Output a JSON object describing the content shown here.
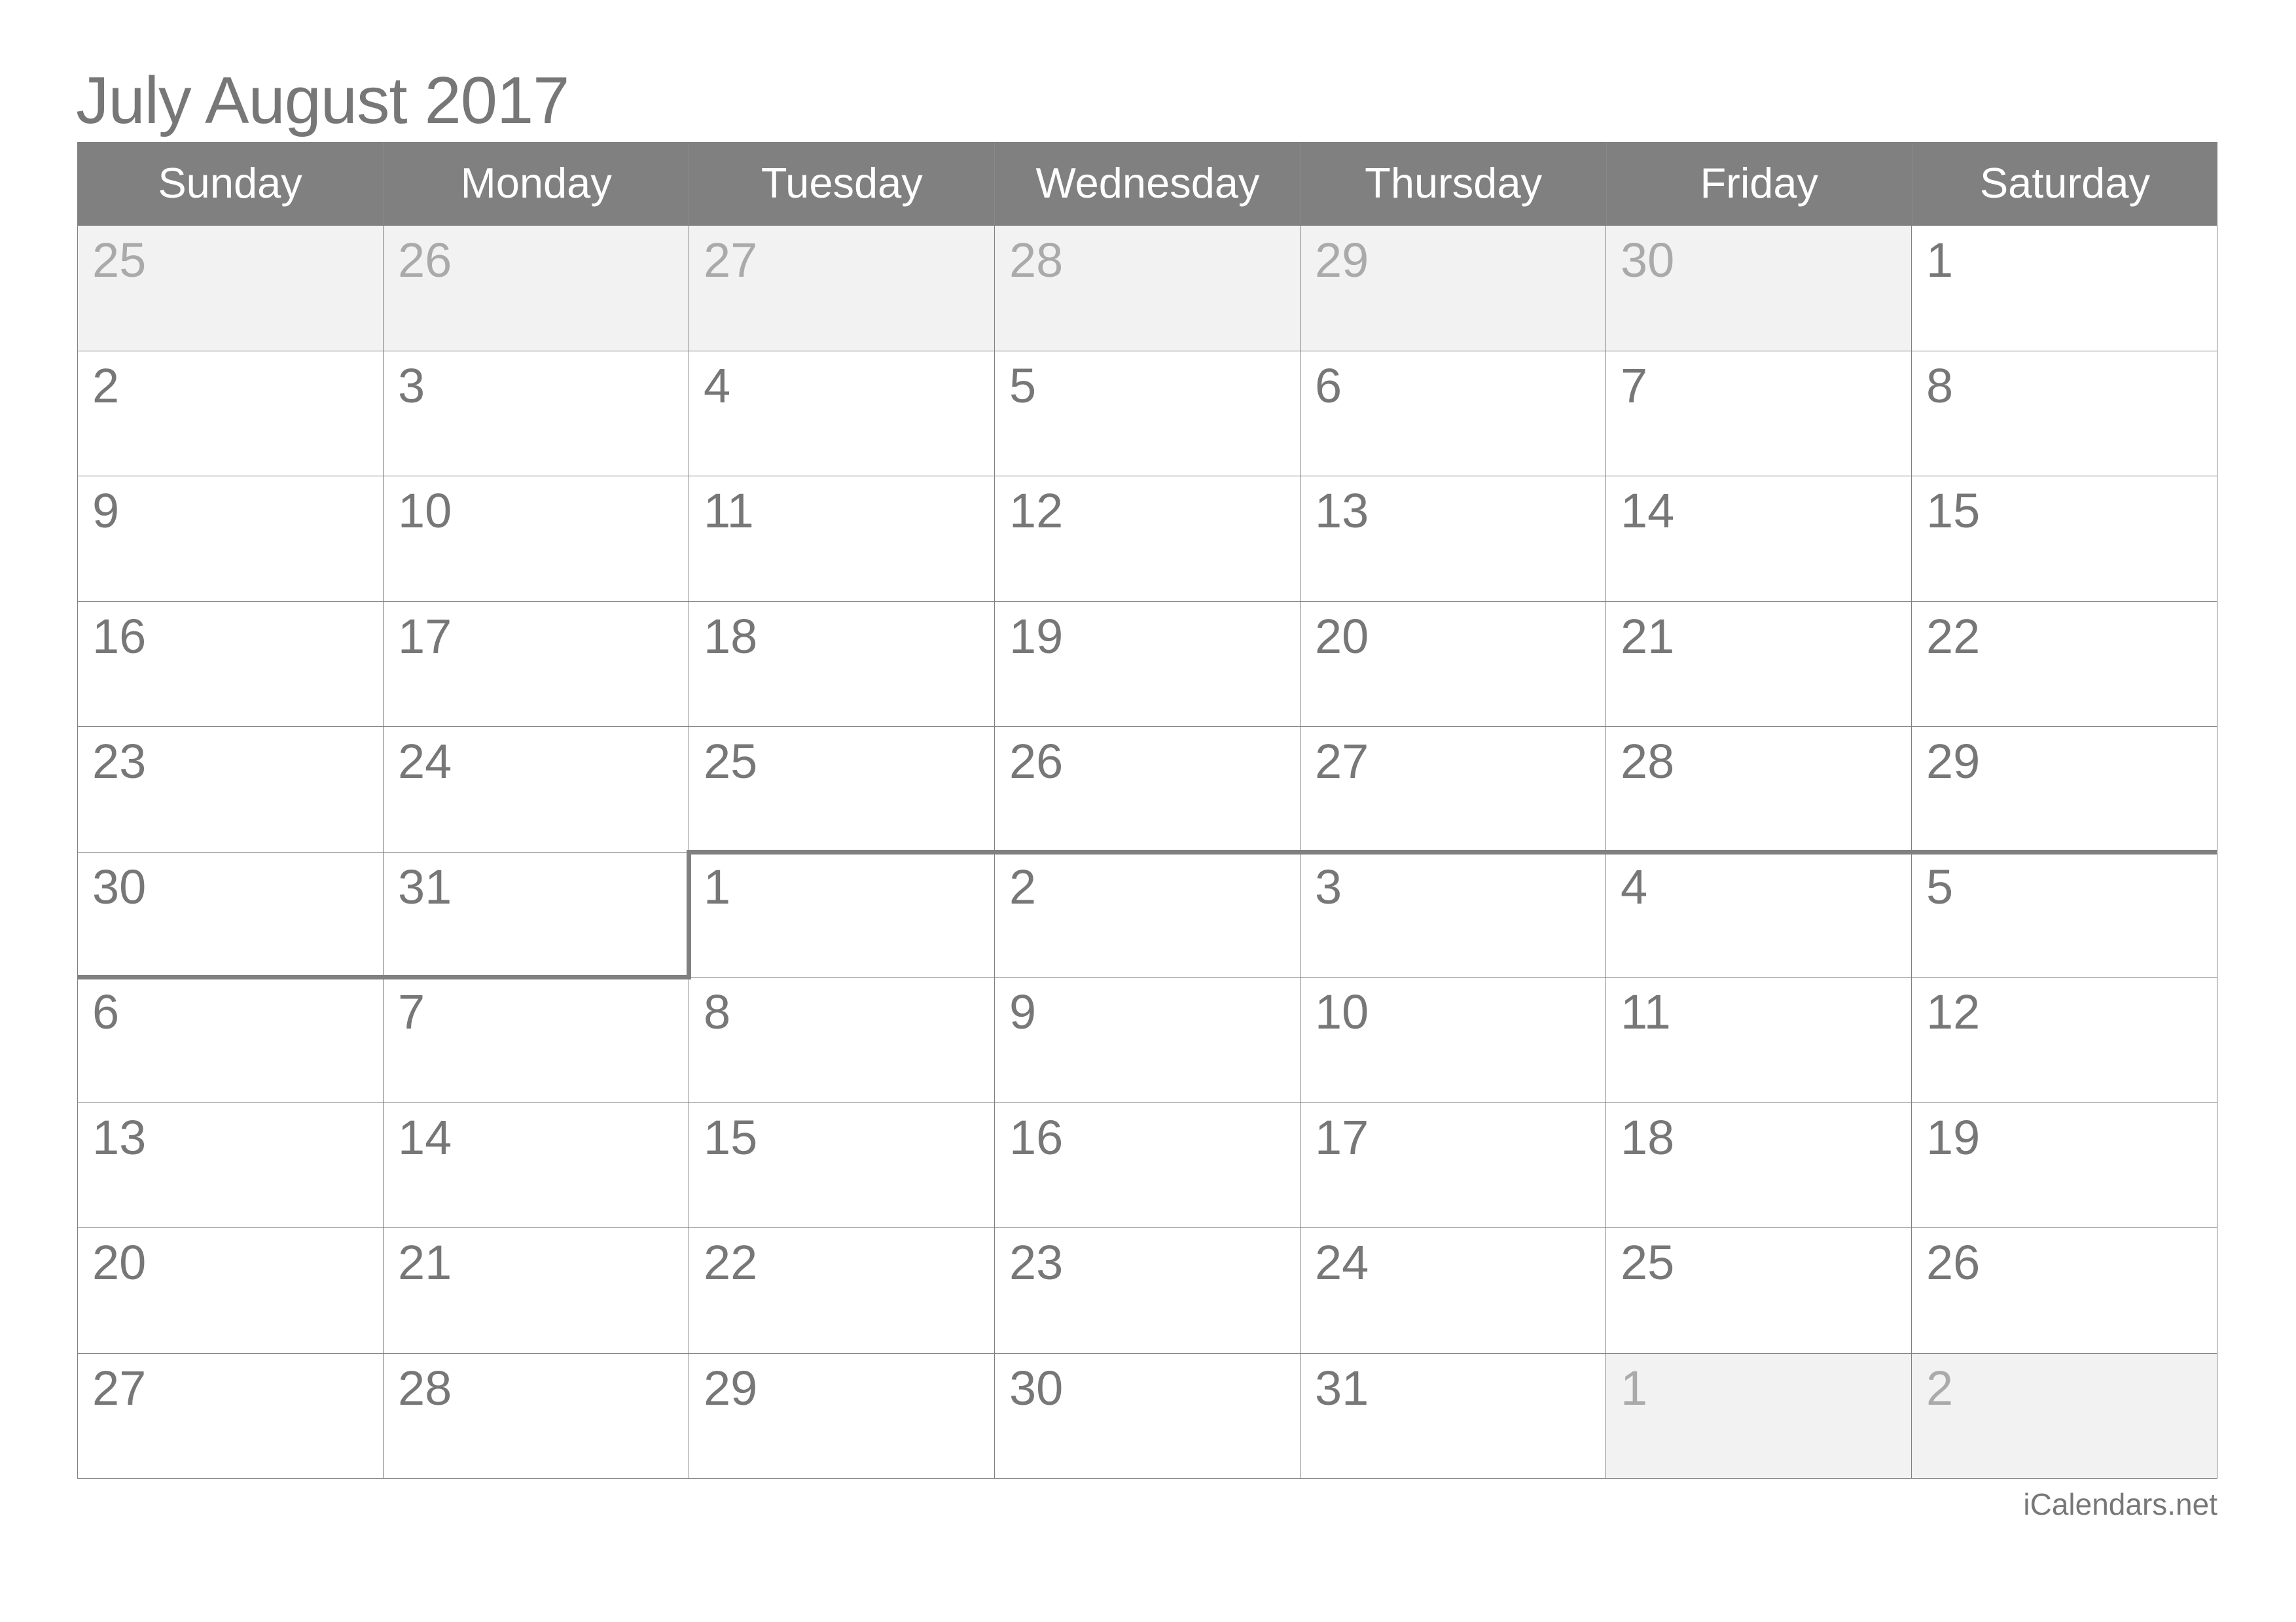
{
  "title": "July August 2017",
  "weekdays": [
    "Sunday",
    "Monday",
    "Tuesday",
    "Wednesday",
    "Thursday",
    "Friday",
    "Saturday"
  ],
  "weeks": [
    [
      {
        "d": "25",
        "other": true
      },
      {
        "d": "26",
        "other": true
      },
      {
        "d": "27",
        "other": true
      },
      {
        "d": "28",
        "other": true
      },
      {
        "d": "29",
        "other": true
      },
      {
        "d": "30",
        "other": true
      },
      {
        "d": "1",
        "other": false
      }
    ],
    [
      {
        "d": "2"
      },
      {
        "d": "3"
      },
      {
        "d": "4"
      },
      {
        "d": "5"
      },
      {
        "d": "6"
      },
      {
        "d": "7"
      },
      {
        "d": "8"
      }
    ],
    [
      {
        "d": "9"
      },
      {
        "d": "10"
      },
      {
        "d": "11"
      },
      {
        "d": "12"
      },
      {
        "d": "13"
      },
      {
        "d": "14"
      },
      {
        "d": "15"
      }
    ],
    [
      {
        "d": "16"
      },
      {
        "d": "17"
      },
      {
        "d": "18"
      },
      {
        "d": "19"
      },
      {
        "d": "20"
      },
      {
        "d": "21"
      },
      {
        "d": "22"
      }
    ],
    [
      {
        "d": "23"
      },
      {
        "d": "24"
      },
      {
        "d": "25"
      },
      {
        "d": "26"
      },
      {
        "d": "27"
      },
      {
        "d": "28"
      },
      {
        "d": "29"
      }
    ],
    [
      {
        "d": "30"
      },
      {
        "d": "31"
      },
      {
        "d": "1"
      },
      {
        "d": "2"
      },
      {
        "d": "3"
      },
      {
        "d": "4"
      },
      {
        "d": "5"
      }
    ],
    [
      {
        "d": "6"
      },
      {
        "d": "7"
      },
      {
        "d": "8"
      },
      {
        "d": "9"
      },
      {
        "d": "10"
      },
      {
        "d": "11"
      },
      {
        "d": "12"
      }
    ],
    [
      {
        "d": "13"
      },
      {
        "d": "14"
      },
      {
        "d": "15"
      },
      {
        "d": "16"
      },
      {
        "d": "17"
      },
      {
        "d": "18"
      },
      {
        "d": "19"
      }
    ],
    [
      {
        "d": "20"
      },
      {
        "d": "21"
      },
      {
        "d": "22"
      },
      {
        "d": "23"
      },
      {
        "d": "24"
      },
      {
        "d": "25"
      },
      {
        "d": "26"
      }
    ],
    [
      {
        "d": "27"
      },
      {
        "d": "28"
      },
      {
        "d": "29"
      },
      {
        "d": "30"
      },
      {
        "d": "31"
      },
      {
        "d": "1",
        "other": true
      },
      {
        "d": "2",
        "other": true
      }
    ]
  ],
  "month_boundary": {
    "week": 5,
    "weekday": 2
  },
  "footer": "iCalendars.net",
  "colors": {
    "header_bg": "#808080",
    "text": "#777777",
    "muted_text": "#aaaaaa",
    "shaded_bg": "#f2f2f2"
  }
}
